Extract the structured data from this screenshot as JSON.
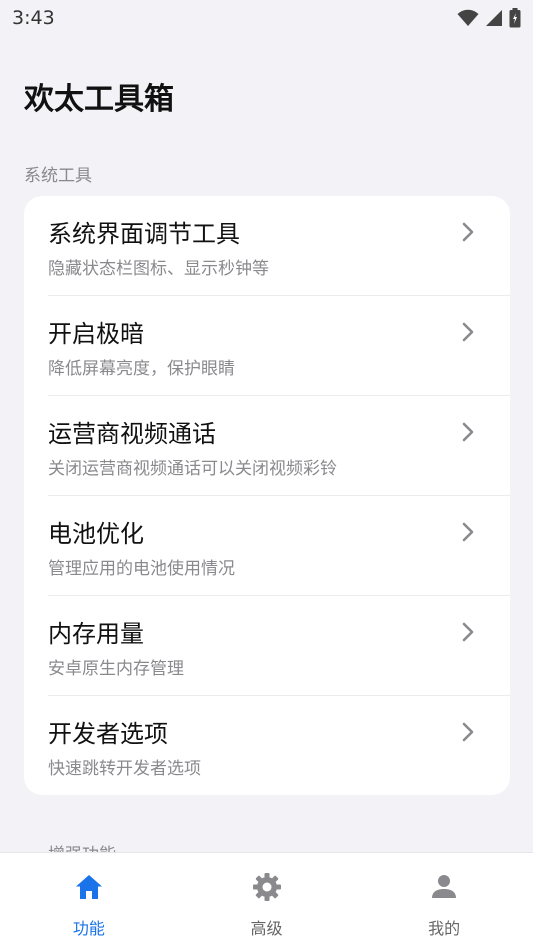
{
  "status_bar": {
    "time": "3:43"
  },
  "app": {
    "title": "欢太工具箱"
  },
  "sections": [
    {
      "header": "系统工具",
      "items": [
        {
          "title": "系统界面调节工具",
          "subtitle": "隐藏状态栏图标、显示秒钟等"
        },
        {
          "title": "开启极暗",
          "subtitle": "降低屏幕亮度，保护眼睛"
        },
        {
          "title": "运营商视频通话",
          "subtitle": "关闭运营商视频通话可以关闭视频彩铃"
        },
        {
          "title": "电池优化",
          "subtitle": "管理应用的电池使用情况"
        },
        {
          "title": "内存用量",
          "subtitle": "安卓原生内存管理"
        },
        {
          "title": "开发者选项",
          "subtitle": "快速跳转开发者选项"
        }
      ]
    },
    {
      "header": "增强功能"
    }
  ],
  "bottom_nav": {
    "items": [
      {
        "label": "功能",
        "icon": "home-icon",
        "active": true
      },
      {
        "label": "高级",
        "icon": "gear-icon",
        "active": false
      },
      {
        "label": "我的",
        "icon": "person-icon",
        "active": false
      }
    ]
  },
  "colors": {
    "background": "#f2f2f7",
    "card": "#ffffff",
    "accent": "#1a73e8",
    "inactive_icon": "#8a8a8e",
    "subtitle": "#8a8a8e"
  }
}
